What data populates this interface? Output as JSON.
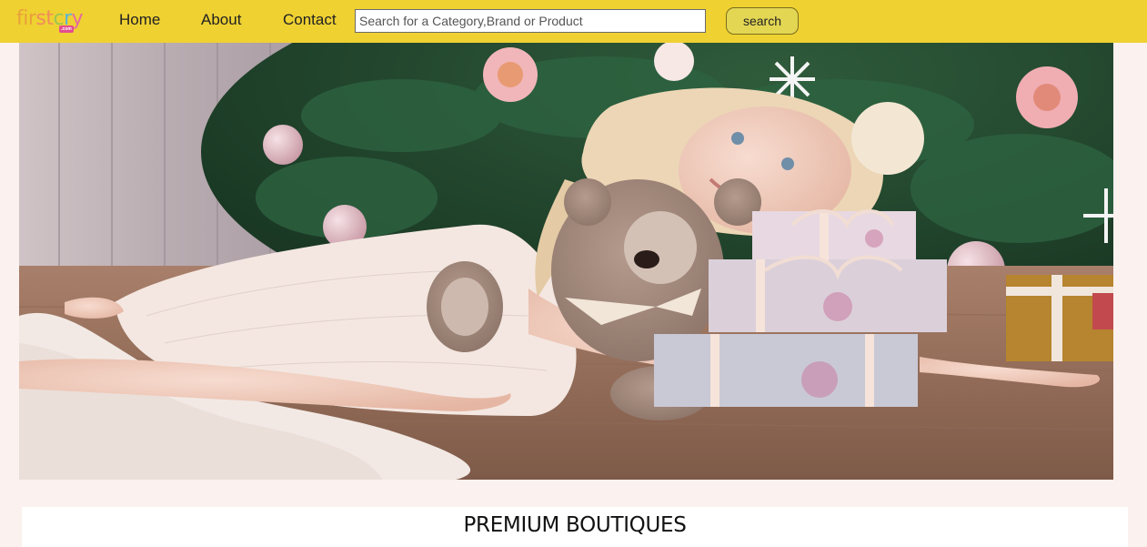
{
  "brand": {
    "logo_text_parts": [
      "fir",
      "st",
      "c",
      "r",
      "y"
    ],
    "logo_badge": ".com"
  },
  "nav": {
    "items": [
      {
        "label": "Home"
      },
      {
        "label": "About"
      },
      {
        "label": "Contact"
      }
    ]
  },
  "search": {
    "placeholder": "Search for a Category,Brand or Product",
    "value": "",
    "button_label": "search"
  },
  "hero": {
    "description": "Girl in white lace dress lying by a Christmas tree, hugging a teddy bear and stacked gift boxes",
    "alt": "hero-banner"
  },
  "section": {
    "title": "PREMIUM BOUTIQUES"
  },
  "colors": {
    "navbar": "#efd132",
    "page_background": "#fbf1ef",
    "search_button": "#e3d653",
    "section_background": "#ffffff"
  }
}
